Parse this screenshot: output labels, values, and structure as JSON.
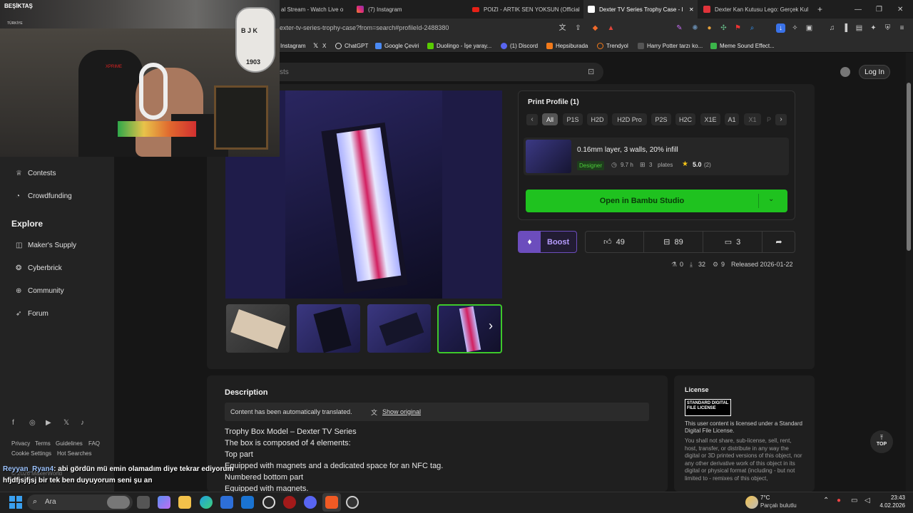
{
  "tabs": [
    {
      "label": "al Stream - Watch Live o"
    },
    {
      "label": "(7) Instagram"
    },
    {
      "label": "POIZI - ARTIK SEN YOKSUN (Official"
    },
    {
      "label": "Dexter TV Series Trophy Case - I"
    },
    {
      "label": "Dexter Kan Kutusu Lego: Gerçek Kul"
    }
  ],
  "address": "exter-tv-series-trophy-case?from=search#profileId-2488380",
  "bookmarks": [
    "Instagram",
    "X",
    "ChatGPT",
    "Google Çeviri",
    "Duolingo - İşe yaray...",
    "(1) Discord",
    "Hepsiburada",
    "Trendyol",
    "Harry Potter tarzı ko...",
    "Meme Sound Effect..."
  ],
  "header": {
    "search_placeholder": "sts",
    "login": "Log In"
  },
  "sidebar": {
    "items": [
      {
        "label": "Contests"
      },
      {
        "label": "Crowdfunding"
      }
    ],
    "explore_title": "Explore",
    "explore": [
      {
        "label": "Maker's Supply"
      },
      {
        "label": "Cyberbrick"
      },
      {
        "label": "Community"
      },
      {
        "label": "Forum"
      }
    ],
    "links_row1": [
      "Privacy",
      "Terms",
      "Guidelines",
      "FAQ"
    ],
    "links_row2": [
      "Cookie Settings",
      "Hot Searches"
    ],
    "copyright": "© 2026 MakerWorld"
  },
  "print_profile": {
    "title": "Print Profile (1)",
    "filters": [
      "All",
      "P1S",
      "H2D",
      "H2D Pro",
      "P2S",
      "H2C",
      "X1E",
      "A1",
      "X1",
      "P"
    ],
    "name": "0.16mm layer, 3 walls, 20% infill",
    "badge": "Designer",
    "time": "9.7 h",
    "plates_count": "3",
    "plates_label": "plates",
    "rating": "5.0",
    "rating_count": "(2)",
    "open_button": "Open in Bambu Studio"
  },
  "actions": {
    "boost": "Boost",
    "likes": "49",
    "collects": "89",
    "comments": "3"
  },
  "meta": {
    "a": "0",
    "downloads": "32",
    "prints": "9",
    "released": "Released 2026-01-22"
  },
  "description": {
    "title": "Description",
    "notice": "Content has been automatically translated.",
    "show_original": "Show original",
    "lines": [
      "Trophy Box Model – Dexter TV Series",
      "The box is composed of 4 elements:",
      "Top part",
      "Equipped with magnets and a dedicated space for an NFC tag.",
      "Numbered bottom part",
      "Equipped with magnets."
    ]
  },
  "license": {
    "title": "License",
    "logo_line1": "STANDARD DIGITAL",
    "logo_line2": "FILE LICENSE",
    "text1": "This user content is licensed under a Standard Digital File License.",
    "text2": "You shall not share, sub-license, sell, rent, host, transfer, or distribute in any way the digital or 3D printed versions of this object, nor any other derivative work of this object in its digital or physical format (including - but not limited to - remixes of this object,"
  },
  "top_button": "TOP",
  "webcam": {
    "banner": "BEŞİKTAŞ",
    "subtext": "TÜRKİYE",
    "logo_bjk": "B J K",
    "logo_year": "1903"
  },
  "chat": {
    "user": "Reyyan_Ryan4",
    "message": ": abi gördün mü emin olamadım diye tekrar ediyorum",
    "line2": "hfjdfjsjfjsj bir tek ben duyuyorum seni şu an"
  },
  "taskbar": {
    "search": "Ara",
    "temp": "7°C",
    "weather": "Parçalı bulutlu",
    "time": "23:43",
    "date": "4.02.2026"
  }
}
